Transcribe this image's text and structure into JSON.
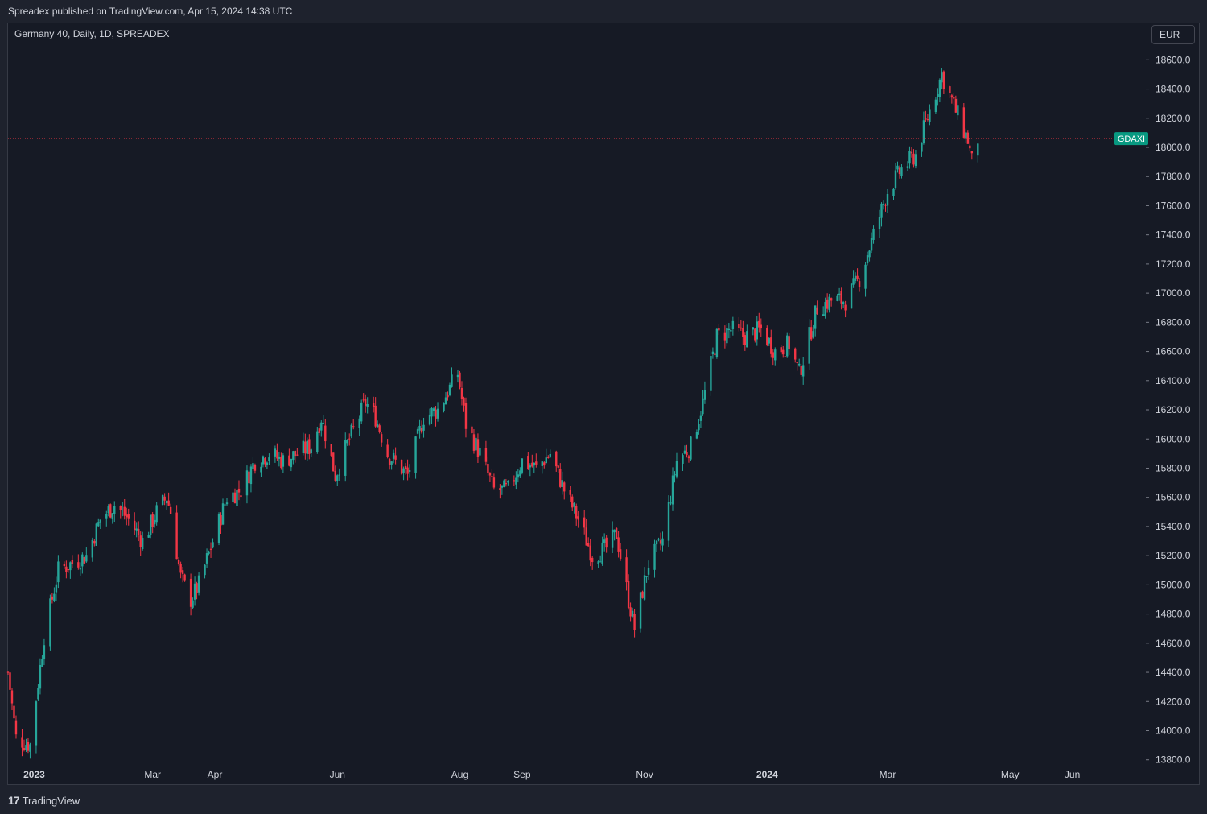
{
  "header": {
    "publisher": "Spreadex published on TradingView.com, Apr 15, 2024 14:38 UTC"
  },
  "symbol_line": "Germany 40, Daily, 1D, SPREADEX",
  "currency_button": "EUR",
  "footer": {
    "brand": "TradingView",
    "logo_icon": "tradingview-logo-icon"
  },
  "colors": {
    "up": "#26a69a",
    "down": "#f23645",
    "price_label_bg": "#089981",
    "price_line": "#f23645"
  },
  "chart_data": {
    "type": "candlestick",
    "symbol": "GDAXI",
    "last_price": 18060,
    "ylim": [
      13700,
      18750
    ],
    "y_ticks": [
      "18600.0",
      "18400.0",
      "18200.0",
      "18000.0",
      "17800.0",
      "17600.0",
      "17400.0",
      "17200.0",
      "17000.0",
      "16800.0",
      "16600.0",
      "16400.0",
      "16200.0",
      "16000.0",
      "15800.0",
      "15600.0",
      "15400.0",
      "15200.0",
      "15000.0",
      "14800.0",
      "14600.0",
      "14400.0",
      "14200.0",
      "14000.0",
      "13800.0"
    ],
    "x_ticks": [
      "2023",
      "Mar",
      "Apr",
      "Jun",
      "Aug",
      "Sep",
      "Nov",
      "2024",
      "Mar",
      "May",
      "Jun"
    ],
    "x_tick_dates": [
      "2023-01-01",
      "2023-03-01",
      "2023-04-01",
      "2023-06-01",
      "2023-08-01",
      "2023-09-01",
      "2023-11-01",
      "2024-01-01",
      "2024-03-01",
      "2024-05-01",
      "2024-06-01"
    ],
    "x_range": [
      "2022-12-19",
      "2024-06-20"
    ],
    "close_series": [
      [
        "2022-12-19",
        14400
      ],
      [
        "2022-12-23",
        13950
      ],
      [
        "2022-12-30",
        13900
      ],
      [
        "2023-01-06",
        14650
      ],
      [
        "2023-01-13",
        15100
      ],
      [
        "2023-01-20",
        15150
      ],
      [
        "2023-01-27",
        15200
      ],
      [
        "2023-02-03",
        15450
      ],
      [
        "2023-02-10",
        15550
      ],
      [
        "2023-02-17",
        15450
      ],
      [
        "2023-02-24",
        15300
      ],
      [
        "2023-03-03",
        15500
      ],
      [
        "2023-03-08",
        15600
      ],
      [
        "2023-03-10",
        15500
      ],
      [
        "2023-03-15",
        15050
      ],
      [
        "2023-03-20",
        14900
      ],
      [
        "2023-03-24",
        15000
      ],
      [
        "2023-03-31",
        15300
      ],
      [
        "2023-04-07",
        15600
      ],
      [
        "2023-04-14",
        15650
      ],
      [
        "2023-04-21",
        15850
      ],
      [
        "2023-04-28",
        15900
      ],
      [
        "2023-05-05",
        15850
      ],
      [
        "2023-05-12",
        15900
      ],
      [
        "2023-05-19",
        15950
      ],
      [
        "2023-05-24",
        16150
      ],
      [
        "2023-05-31",
        15750
      ],
      [
        "2023-06-07",
        16000
      ],
      [
        "2023-06-15",
        16250
      ],
      [
        "2023-06-20",
        16150
      ],
      [
        "2023-06-26",
        15900
      ],
      [
        "2023-07-06",
        15750
      ],
      [
        "2023-07-14",
        16150
      ],
      [
        "2023-07-21",
        16200
      ],
      [
        "2023-07-31",
        16450
      ],
      [
        "2023-08-04",
        16100
      ],
      [
        "2023-08-11",
        15900
      ],
      [
        "2023-08-18",
        15650
      ],
      [
        "2023-08-25",
        15650
      ],
      [
        "2023-09-01",
        15850
      ],
      [
        "2023-09-08",
        15800
      ],
      [
        "2023-09-15",
        15900
      ],
      [
        "2023-09-22",
        15650
      ],
      [
        "2023-09-29",
        15450
      ],
      [
        "2023-10-06",
        15200
      ],
      [
        "2023-10-13",
        15250
      ],
      [
        "2023-10-18",
        15350
      ],
      [
        "2023-10-24",
        14900
      ],
      [
        "2023-10-27",
        14700
      ],
      [
        "2023-11-03",
        15150
      ],
      [
        "2023-11-10",
        15300
      ],
      [
        "2023-11-17",
        15850
      ],
      [
        "2023-11-24",
        15950
      ],
      [
        "2023-11-30",
        16250
      ],
      [
        "2023-12-07",
        16700
      ],
      [
        "2023-12-14",
        16750
      ],
      [
        "2023-12-21",
        16700
      ],
      [
        "2023-12-29",
        16750
      ],
      [
        "2024-01-05",
        16600
      ],
      [
        "2024-01-12",
        16650
      ],
      [
        "2024-01-17",
        16450
      ],
      [
        "2024-01-26",
        16900
      ],
      [
        "2024-02-02",
        16950
      ],
      [
        "2024-02-09",
        16950
      ],
      [
        "2024-02-16",
        17100
      ],
      [
        "2024-02-23",
        17400
      ],
      [
        "2024-03-01",
        17700
      ],
      [
        "2024-03-08",
        17850
      ],
      [
        "2024-03-15",
        17950
      ],
      [
        "2024-03-22",
        18250
      ],
      [
        "2024-03-28",
        18500
      ],
      [
        "2024-04-04",
        18250
      ],
      [
        "2024-04-10",
        18050
      ],
      [
        "2024-04-12",
        17900
      ],
      [
        "2024-04-15",
        18060
      ]
    ]
  }
}
